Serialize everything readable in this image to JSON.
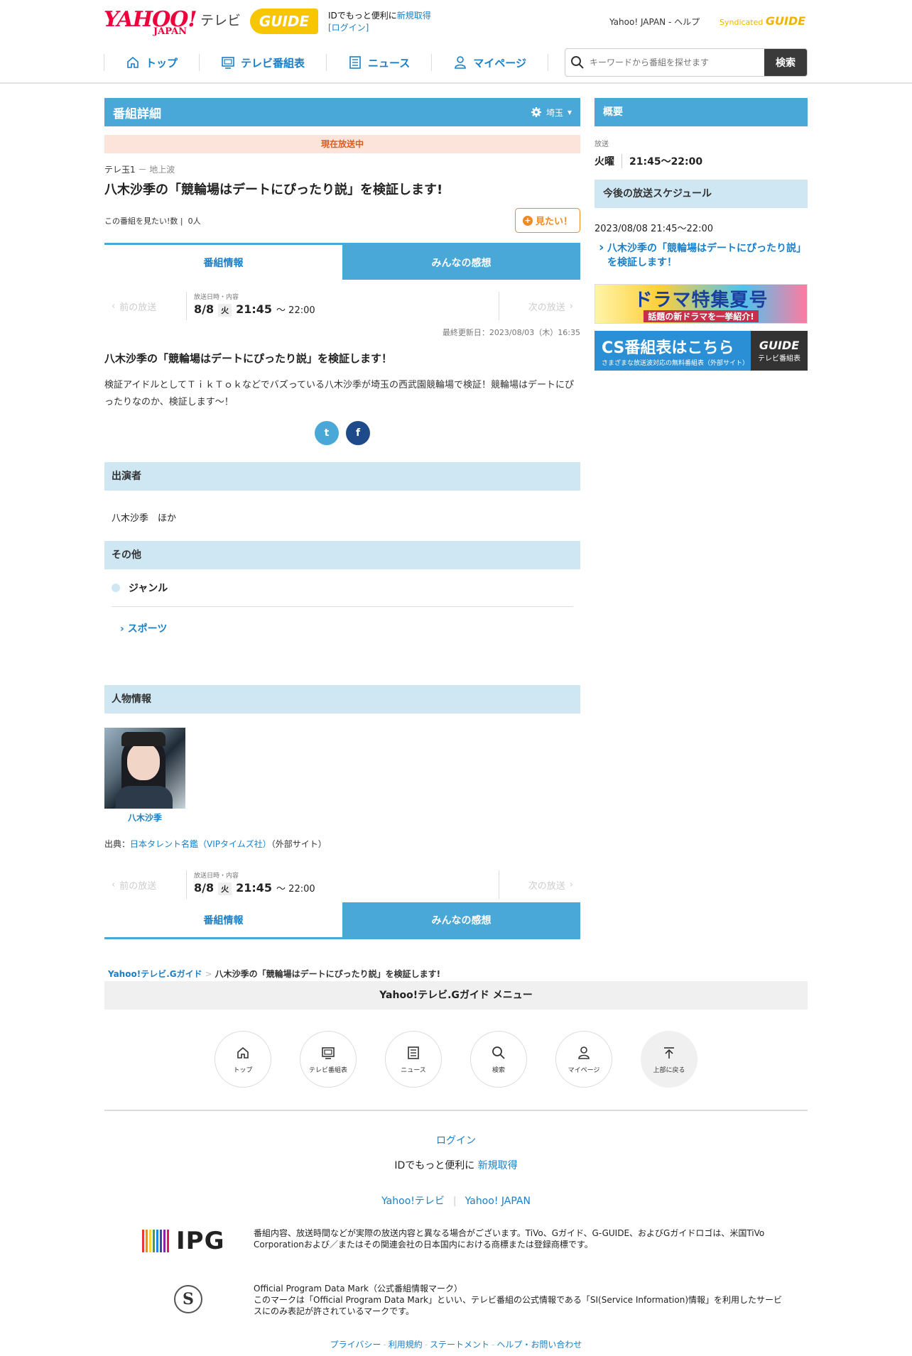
{
  "header": {
    "logo_yahoo": "YAHOO!",
    "logo_japan": "JAPAN",
    "logo_tv": "テレビ",
    "logo_gguide": "GUIDE",
    "id_text": "IDでもっと便利に",
    "signup": "新規取得",
    "login": "[ログイン]",
    "yahoo_japan": "Yahoo! JAPAN",
    "help": "ヘルプ",
    "syndicated": "Syndicated",
    "syndicated_guide": "GUIDE"
  },
  "nav": {
    "top": "トップ",
    "tv_guide": "テレビ番組表",
    "news": "ニュース",
    "mypage": "マイページ"
  },
  "search": {
    "placeholder": "キーワードから番組を探せます",
    "button": "検索"
  },
  "detail": {
    "heading": "番組詳細",
    "region": "埼玉",
    "on_air": "現在放送中",
    "channel": "テレ玉1",
    "channel_sub": "－ 地上波",
    "title": "八木沙季の「競輪場はデートにぴったり説」を検証します!",
    "want_count_label": "この番組を見たい!数",
    "want_count": "0人",
    "want_button": "見たい！"
  },
  "tabs": {
    "info": "番組情報",
    "reviews": "みんなの感想"
  },
  "broadcast": {
    "prev": "前の放送",
    "next": "次の放送",
    "label": "放送日時・内容",
    "date": "8/8",
    "dow": "火",
    "start": "21:45",
    "end": "～ 22:00",
    "updated": "最終更新日：2023/08/03（木）16:35"
  },
  "description": {
    "title": "八木沙季の「競輪場はデートにぴったり説」を検証します！",
    "body": "検証アイドルとしてＴｉｋＴｏｋなどでバズっている八木沙季が埼玉の西武園競輪場で検証！競輪場はデートにぴったりなのか、検証します～！"
  },
  "share": {
    "twitter": "t",
    "facebook": "f"
  },
  "cast": {
    "heading": "出演者",
    "names": "八木沙季　ほか"
  },
  "other": {
    "heading": "その他",
    "genre_label": "ジャンル",
    "genre_link": "スポーツ"
  },
  "people": {
    "heading": "人物情報",
    "name": "八木沙季",
    "credit_prefix": "出典：",
    "credit_link": "日本タレント名鑑（VIPタイムズ社）",
    "credit_suffix": "（外部サイト）"
  },
  "breadcrumb": {
    "root": "Yahoo!テレビ.Gガイド",
    "current": "八木沙季の「競輪場はデートにぴったり説」を検証します!"
  },
  "sidebar": {
    "summary": "概要",
    "broadcast_label": "放送",
    "day": "火曜",
    "time": "21:45～22:00",
    "schedule_heading": "今後の放送スケジュール",
    "schedule_date": "2023/08/08 21:45～22:00",
    "schedule_link": "八木沙季の「競輪場はデートにぴったり説」を検証します！",
    "banner1_title": "ドラマ特集夏号",
    "banner1_sub": "話題の新ドラマを一挙紹介!",
    "banner2_title": "CS番組表はこちら",
    "banner2_sub": "さまざまな放送波対応の無料番組表（外部サイト）",
    "banner2_brand": "GUIDE",
    "banner2_brand_sub": "テレビ番組表"
  },
  "footer": {
    "menu_title": "Yahoo!テレビ.Gガイド メニュー",
    "menu": [
      "トップ",
      "テレビ番組表",
      "ニュース",
      "検索",
      "マイページ",
      "上部に戻る"
    ],
    "login": "ログイン",
    "id_text": "IDでもっと便利に",
    "signup": "新規取得",
    "link_tv": "Yahoo!テレビ",
    "link_japan": "Yahoo! JAPAN",
    "ipg": "IPG",
    "note1": "番組内容、放送時間などが実際の放送内容と異なる場合がございます。TiVo、Gガイド、G-GUIDE、およびGガイドロゴは、米国TiVo Corporationおよび／またはその関連会社の日本国内における商標または登録商標です。",
    "smark": "S",
    "note2_title": "Official Program Data Mark（公式番組情報マーク）",
    "note2_body": "このマークは「Official Program Data Mark」といい、テレビ番組の公式情報である「SI(Service Information)情報」を利用したサービスにのみ表記が許されているマークです。",
    "bottom_links": [
      "プライバシー",
      "利用規約",
      "ステートメント",
      "ヘルプ・お問い合わせ"
    ]
  },
  "colors": {
    "accent": "#4aa8d8",
    "link": "#1a7fc7",
    "section": "#cfe6f3",
    "yahoo_red": "#f0003c",
    "gguide_yellow": "#f7c600",
    "want_orange": "#f08a24"
  }
}
